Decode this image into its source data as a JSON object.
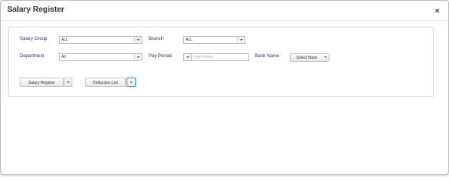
{
  "dialog": {
    "title": "Salary Register",
    "close_glyph": "×"
  },
  "filters": {
    "salary_group": {
      "label": "Salary Group",
      "value": "ALL"
    },
    "branch": {
      "label": "Branch",
      "value": "ALL"
    },
    "department": {
      "label": "Department",
      "value": "All"
    },
    "pay_period": {
      "label": "Pay Period",
      "placeholder": "Pay Period"
    },
    "bank_name": {
      "label": "Bank Name",
      "value": "Select Bank"
    }
  },
  "actions": {
    "salary_register": "Salary Register",
    "deduction_list": "Deduction List"
  },
  "icons": {
    "close": "close-icon",
    "dropdown": "chevron-down-icon"
  },
  "colors": {
    "label_text": "#2a2a7a",
    "focus_border": "#5b9bd5"
  }
}
